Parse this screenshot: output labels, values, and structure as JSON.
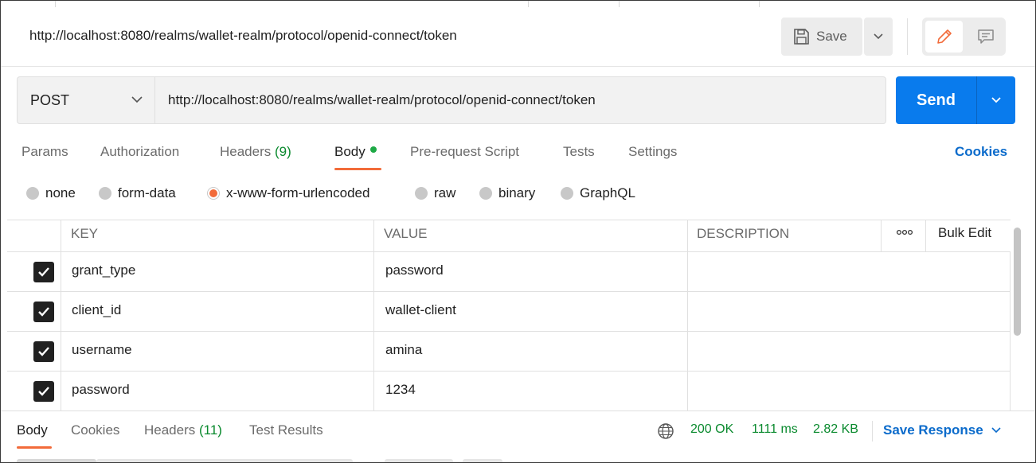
{
  "header": {
    "title": "http://localhost:8080/realms/wallet-realm/protocol/openid-connect/token",
    "save_label": "Save"
  },
  "request": {
    "method": "POST",
    "url": "http://localhost:8080/realms/wallet-realm/protocol/openid-connect/token",
    "send_label": "Send"
  },
  "tabs": {
    "params": "Params",
    "authorization": "Authorization",
    "headers": "Headers",
    "headers_count": "(9)",
    "body": "Body",
    "prerequest": "Pre-request Script",
    "tests": "Tests",
    "settings": "Settings",
    "cookies": "Cookies"
  },
  "body_types": {
    "none": "none",
    "form_data": "form-data",
    "urlencoded": "x-www-form-urlencoded",
    "raw": "raw",
    "binary": "binary",
    "graphql": "GraphQL",
    "selected": "x-www-form-urlencoded"
  },
  "table": {
    "headers": {
      "key": "KEY",
      "value": "VALUE",
      "description": "DESCRIPTION",
      "bulk_edit": "Bulk Edit"
    },
    "rows": [
      {
        "key": "grant_type",
        "value": "password",
        "description": "",
        "checked": true
      },
      {
        "key": "client_id",
        "value": "wallet-client",
        "description": "",
        "checked": true
      },
      {
        "key": "username",
        "value": "amina",
        "description": "",
        "checked": true
      },
      {
        "key": "password",
        "value": "1234",
        "description": "",
        "checked": true
      }
    ]
  },
  "response": {
    "tabs": {
      "body": "Body",
      "cookies": "Cookies",
      "headers": "Headers",
      "headers_count": "(11)",
      "test_results": "Test Results"
    },
    "status": "200 OK",
    "time": "1111 ms",
    "size": "2.82 KB",
    "save_response": "Save Response"
  },
  "colors": {
    "accent_orange": "#f26b3a",
    "send_blue": "#097bed",
    "link_blue": "#0b6bcb",
    "success_green": "#0a8a2e"
  },
  "icons": {
    "save": "save-icon",
    "edit": "pencil-icon",
    "comment": "comment-icon",
    "globe": "globe-icon",
    "more": "more-horizontal-icon"
  }
}
